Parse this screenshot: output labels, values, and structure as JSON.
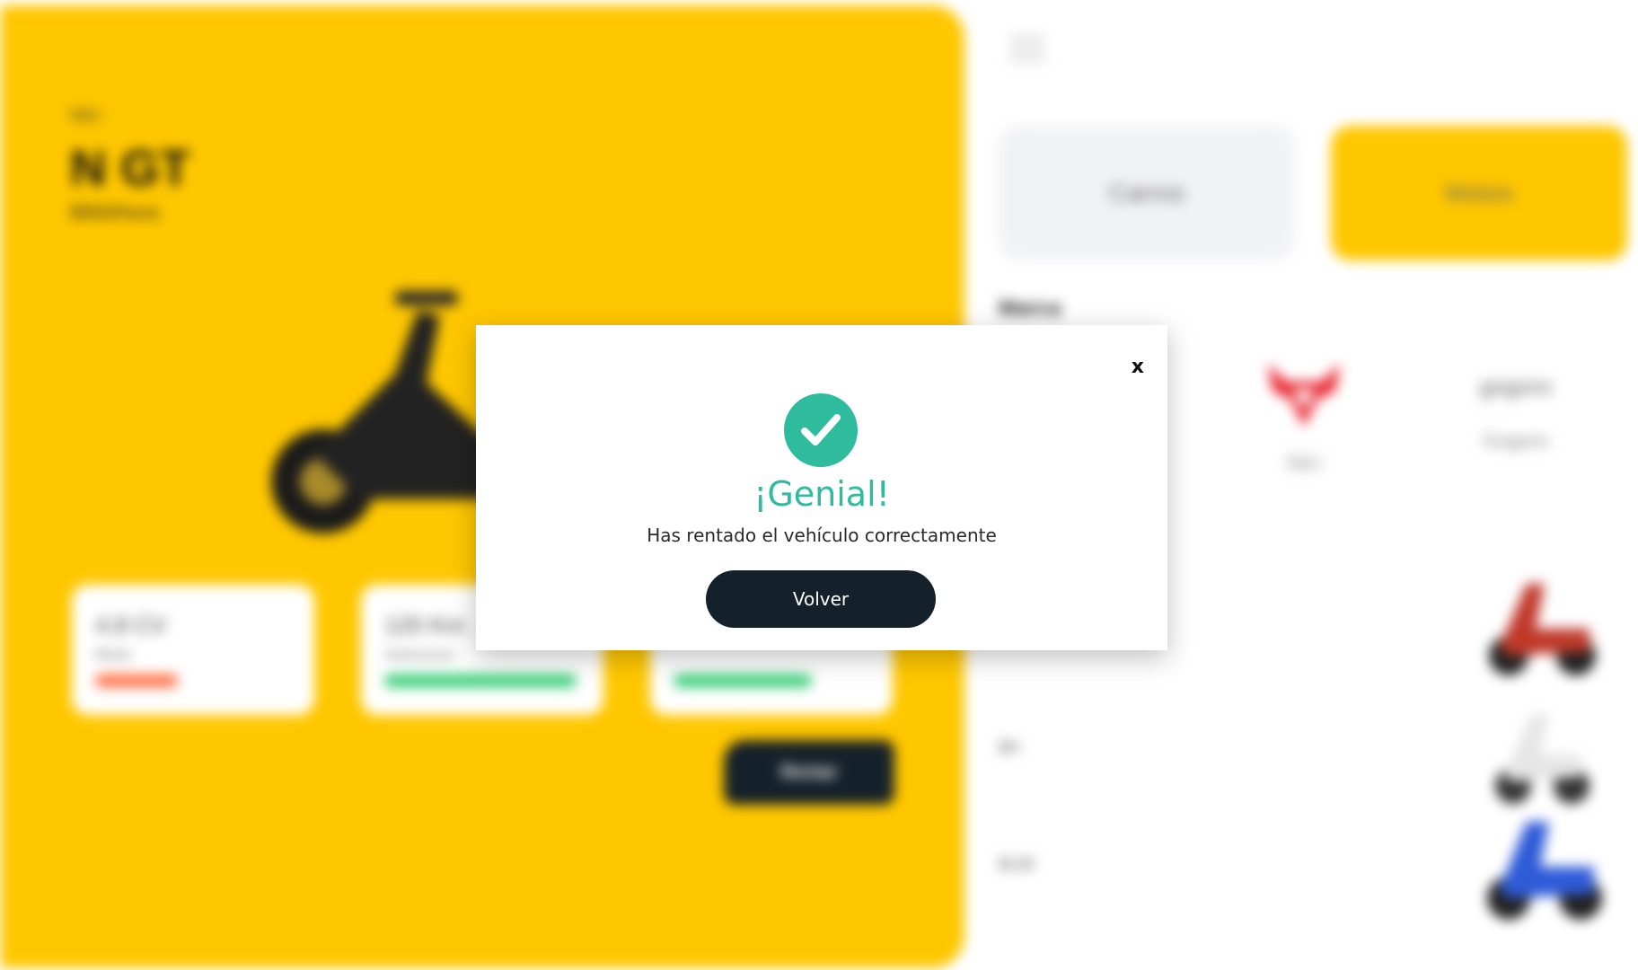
{
  "background": {
    "detail": {
      "brand": "NIU",
      "model": "N GT",
      "price": "$900/hora",
      "specs": [
        {
          "value": "4.8 CV",
          "label": "Motor",
          "bar_color": "#FF6A3D",
          "level": 0.35
        },
        {
          "value": "120 Km",
          "label": "Autonomía",
          "bar_color": "#2ECC71",
          "level": 0.85
        },
        {
          "value": "",
          "label": "",
          "bar_color": "#2ECC71",
          "level": 0.55
        }
      ],
      "rent_button": "Rentar"
    },
    "categories": {
      "cars": "Carros",
      "motos": "Motos"
    },
    "brand_section_label": "Marca",
    "brands": [
      {
        "name": "NIU",
        "icon": "niu-bull-logo-icon"
      },
      {
        "name": "Gogoro",
        "icon": "gogoro-wordmark-icon",
        "wordmark": "gogoro"
      }
    ],
    "list_prices": [
      "$H",
      "$L00"
    ]
  },
  "modal": {
    "close_label": "x",
    "title": "¡Genial!",
    "message": "Has rentado el vehículo correctamente",
    "button": "Volver",
    "icon": "check-circle-icon",
    "accent_color": "#2FBB9E"
  }
}
